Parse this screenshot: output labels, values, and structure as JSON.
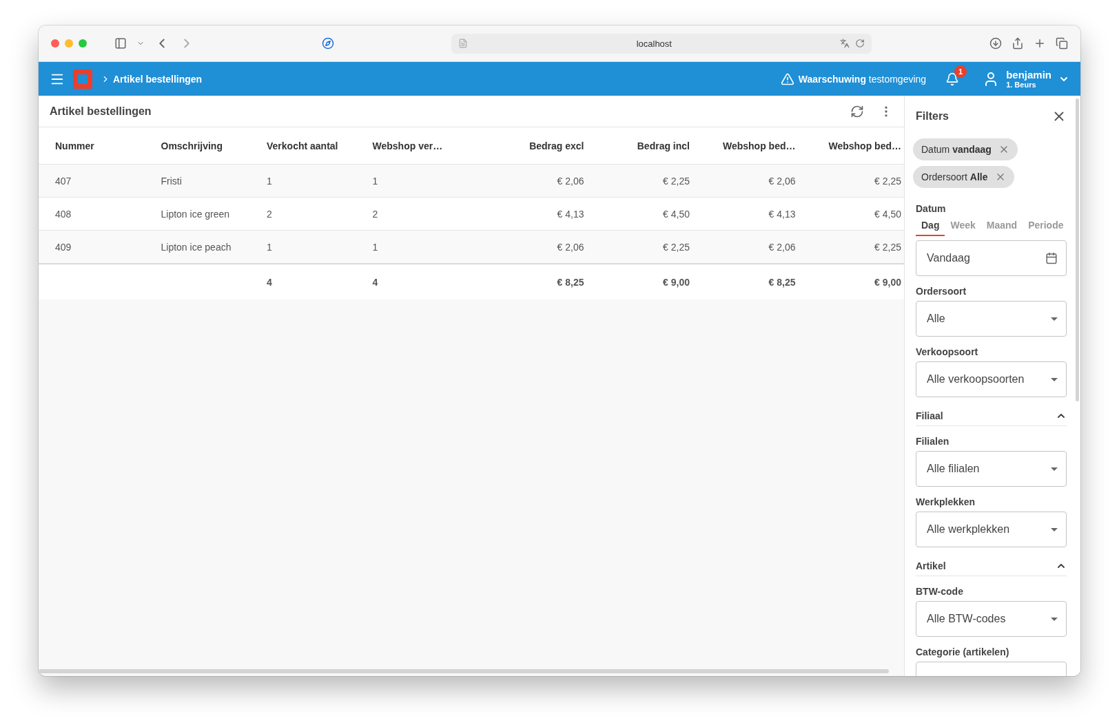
{
  "browser": {
    "url": "localhost"
  },
  "header": {
    "breadcrumb": "Artikel bestellingen",
    "warning": "**Waarschuwing** testomgeving",
    "notifications": "1",
    "user": {
      "name": "benjamin",
      "location": "1. Beurs"
    }
  },
  "report": {
    "title": "Artikel bestellingen",
    "columns": [
      {
        "label": "Nummer",
        "kind": "text"
      },
      {
        "label": "Omschrijving",
        "kind": "text"
      },
      {
        "label": "Verkocht aantal",
        "kind": "text"
      },
      {
        "label": "Webshop ver…",
        "kind": "text"
      },
      {
        "label": "Bedrag excl",
        "kind": "amount"
      },
      {
        "label": "Bedrag incl",
        "kind": "amount"
      },
      {
        "label": "Webshop bed…",
        "kind": "amount"
      },
      {
        "label": "Webshop bed…",
        "kind": "amount"
      }
    ],
    "rows": [
      [
        "407",
        "Fristi",
        "1",
        "1",
        "€ 2,06",
        "€ 2,25",
        "€ 2,06",
        "€ 2,25"
      ],
      [
        "408",
        "Lipton ice green",
        "2",
        "2",
        "€ 4,13",
        "€ 4,50",
        "€ 4,13",
        "€ 4,50"
      ],
      [
        "409",
        "Lipton ice peach",
        "1",
        "1",
        "€ 2,06",
        "€ 2,25",
        "€ 2,06",
        "€ 2,25"
      ]
    ],
    "totals": [
      "4",
      "4",
      "€ 8,25",
      "€ 9,00",
      "€ 8,25",
      "€ 9,00"
    ]
  },
  "filters": {
    "title": "Filters",
    "chips": [
      "Datum **vandaag**",
      "Ordersoort **Alle**"
    ],
    "items": [
      {
        "kind": "date",
        "label": "Datum",
        "tabs": [
          {
            "label": "Dag",
            "selected": true
          },
          {
            "label": "Week",
            "selected": false
          },
          {
            "label": "Maand",
            "selected": false
          },
          {
            "label": "Periode",
            "selected": false
          }
        ],
        "value": "Vandaag"
      },
      {
        "kind": "select",
        "label": "Ordersoort",
        "value": "Alle"
      },
      {
        "kind": "select",
        "label": "Verkoopsoort",
        "value": "Alle verkoopsoorten"
      },
      {
        "kind": "section",
        "label": "Filiaal",
        "expanded": true
      },
      {
        "kind": "select",
        "label": "Filialen",
        "value": "Alle filialen"
      },
      {
        "kind": "select",
        "label": "Werkplekken",
        "value": "Alle werkplekken"
      },
      {
        "kind": "section",
        "label": "Artikel",
        "expanded": true
      },
      {
        "kind": "select",
        "label": "BTW-code",
        "value": "Alle BTW-codes"
      },
      {
        "kind": "select",
        "label": "Categorie (artikelen)"
      }
    ]
  }
}
